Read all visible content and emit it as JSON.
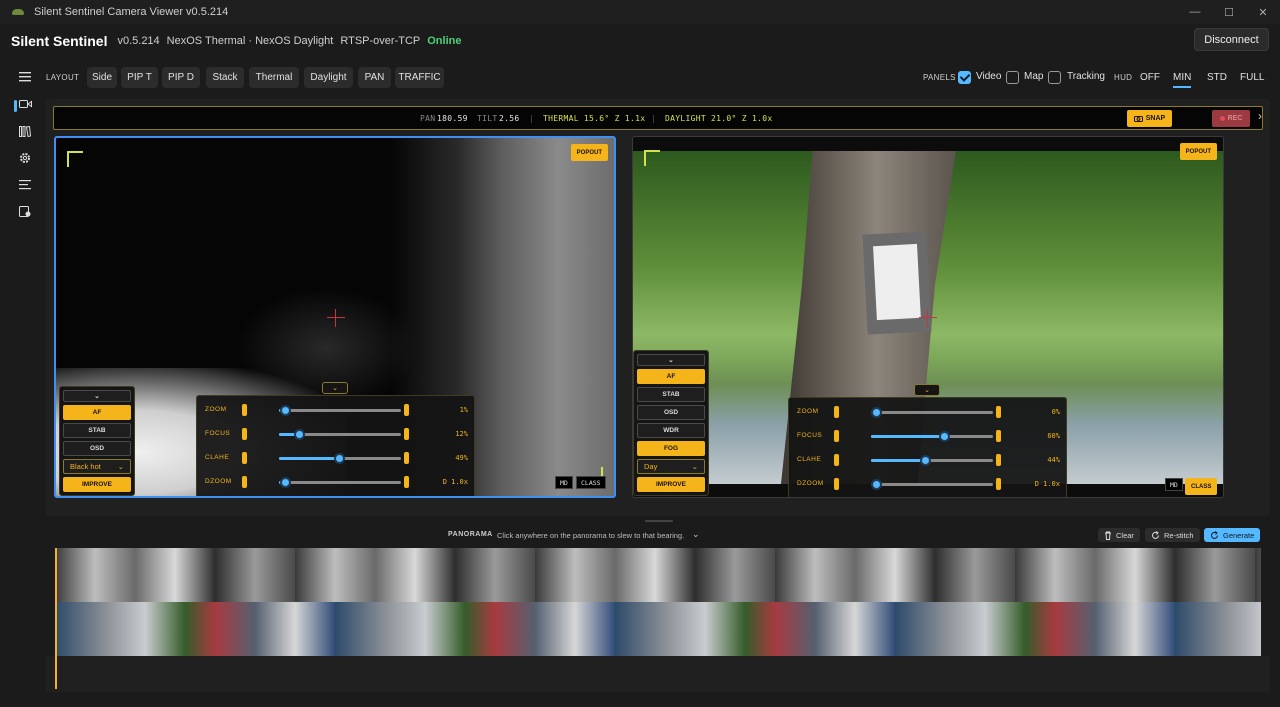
{
  "window": {
    "title": "Silent Sentinel Camera Viewer v0.5.214",
    "controls": [
      "—",
      "☐",
      "✕"
    ]
  },
  "header": {
    "app_name": "Silent Sentinel",
    "version": "v0.5.214",
    "cameras": "NexOS Thermal · NexOS Daylight",
    "transport": "RTSP-over-TCP",
    "status": "Online",
    "disconnect_label": "Disconnect"
  },
  "rail": {
    "icons": [
      "menu-icon",
      "video-icon",
      "library-icon",
      "settings-icon",
      "list-icon",
      "device-icon"
    ]
  },
  "toolbar": {
    "layout_label": "LAYOUT",
    "layouts": [
      "Side",
      "PIP T",
      "PIP D",
      "Stack",
      "Thermal",
      "Daylight",
      "PAN",
      "TRAFFIC"
    ],
    "panels_label": "PANELS",
    "panels": [
      {
        "label": "Video",
        "checked": true
      },
      {
        "label": "Map",
        "checked": false
      },
      {
        "label": "Tracking",
        "checked": false
      }
    ],
    "hud_label": "HUD",
    "hud_options": [
      "OFF",
      "MIN",
      "STD",
      "FULL"
    ],
    "hud_selected": "MIN"
  },
  "infobar": {
    "pan_label": "PAN",
    "pan_value": "180.59",
    "tilt_label": "TILT",
    "tilt_value": "2.56",
    "thermal": "THERMAL 15.6° Z 1.1x",
    "daylight": "DAYLIGHT 21.0° Z 1.0x",
    "snap_label": "SNAP",
    "rec_label": "REC"
  },
  "thermal": {
    "popout_label": "POPOUT",
    "buttons": {
      "af": "AF",
      "stab": "STAB",
      "osd": "OSD",
      "palette": "Black hot",
      "improve": "IMPROVE"
    },
    "sliders": [
      {
        "name": "ZOOM",
        "value": "1%",
        "level": 0.05
      },
      {
        "name": "FOCUS",
        "value": "12%",
        "level": 0.16
      },
      {
        "name": "CLAHE",
        "value": "49%",
        "level": 0.49
      },
      {
        "name": "DZOOM",
        "value": "D 1.0x",
        "level": 0.05
      }
    ],
    "md_label": "MD",
    "class_label": "CLASS"
  },
  "daylight": {
    "popout_label": "POPOUT",
    "buttons": {
      "af": "AF",
      "stab": "STAB",
      "osd": "OSD",
      "wdr": "WDR",
      "fog": "FOG",
      "mode": "Day",
      "improve": "IMPROVE"
    },
    "sliders": [
      {
        "name": "ZOOM",
        "value": "0%",
        "level": 0.04
      },
      {
        "name": "FOCUS",
        "value": "60%",
        "level": 0.6
      },
      {
        "name": "CLAHE",
        "value": "44%",
        "level": 0.44
      },
      {
        "name": "DZOOM",
        "value": "D 1.0x",
        "level": 0.04
      }
    ],
    "md_label": "MD",
    "class_label": "CLASS"
  },
  "panorama": {
    "label": "PANORAMA",
    "hint": "Click anywhere on the panorama to slew to that bearing.",
    "clear_label": "Clear",
    "restitch_label": "Re-stitch",
    "generate_label": "Generate"
  },
  "colors": {
    "accent": "#56b9ff",
    "hud_yellow": "#f4b41a",
    "online": "#4ed07a",
    "rec": "#9b3a40"
  }
}
